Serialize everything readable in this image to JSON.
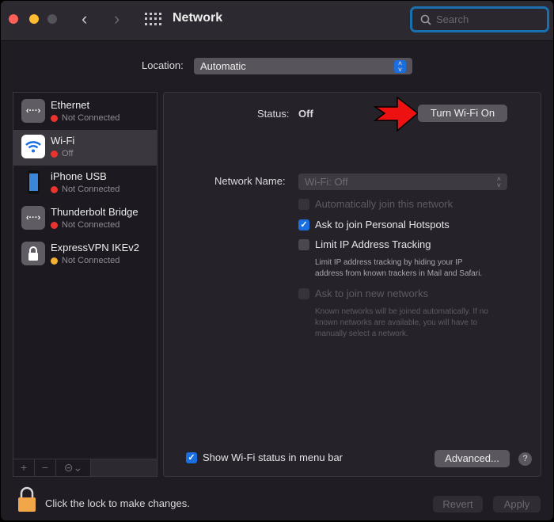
{
  "window": {
    "title": "Network",
    "search_placeholder": "Search"
  },
  "location": {
    "label": "Location:",
    "value": "Automatic"
  },
  "services": [
    {
      "name": "Ethernet",
      "status": "Not Connected",
      "status_color": "#e8332e",
      "icon": "ethernet-icon"
    },
    {
      "name": "Wi-Fi",
      "status": "Off",
      "status_color": "#e8332e",
      "icon": "wifi-icon",
      "selected": true
    },
    {
      "name": "iPhone USB",
      "status": "Not Connected",
      "status_color": "#e8332e",
      "icon": "iphone-icon"
    },
    {
      "name": "Thunderbolt Bridge",
      "status": "Not Connected",
      "status_color": "#e8332e",
      "icon": "thunderbolt-icon"
    },
    {
      "name": "ExpressVPN IKEv2",
      "status": "Not Connected",
      "status_color": "#f2b134",
      "icon": "lock-icon"
    }
  ],
  "sidebar_bar": {
    "add": "+",
    "remove": "−",
    "action": "⊝⌄"
  },
  "detail": {
    "status_label": "Status:",
    "status_value": "Off",
    "turn_on_button": "Turn Wi-Fi On",
    "network_name_label": "Network Name:",
    "network_name_value": "Wi-Fi: Off",
    "options": [
      {
        "label": "Automatically join this network",
        "checked": false,
        "disabled": true
      },
      {
        "label": "Ask to join Personal Hotspots",
        "checked": true,
        "disabled": false
      },
      {
        "label": "Limit IP Address Tracking",
        "checked": false,
        "disabled": false
      },
      {
        "label": "Ask to join new networks",
        "checked": false,
        "disabled": true
      }
    ],
    "limit_ip_desc": [
      "Limit IP address tracking by hiding your IP",
      "address from known trackers in Mail and Safari."
    ],
    "ask_new_desc": [
      "Known networks will be joined automatically. If no",
      "known networks are available, you will have to",
      "manually select a network."
    ],
    "show_status_label": "Show Wi-Fi status in menu bar",
    "advanced_button": "Advanced...",
    "help": "?"
  },
  "footer": {
    "lock_text": "Click the lock to make changes.",
    "revert": "Revert",
    "apply": "Apply"
  },
  "colors": {
    "accent": "#1a6ee0",
    "arrow": "#ee1111"
  }
}
